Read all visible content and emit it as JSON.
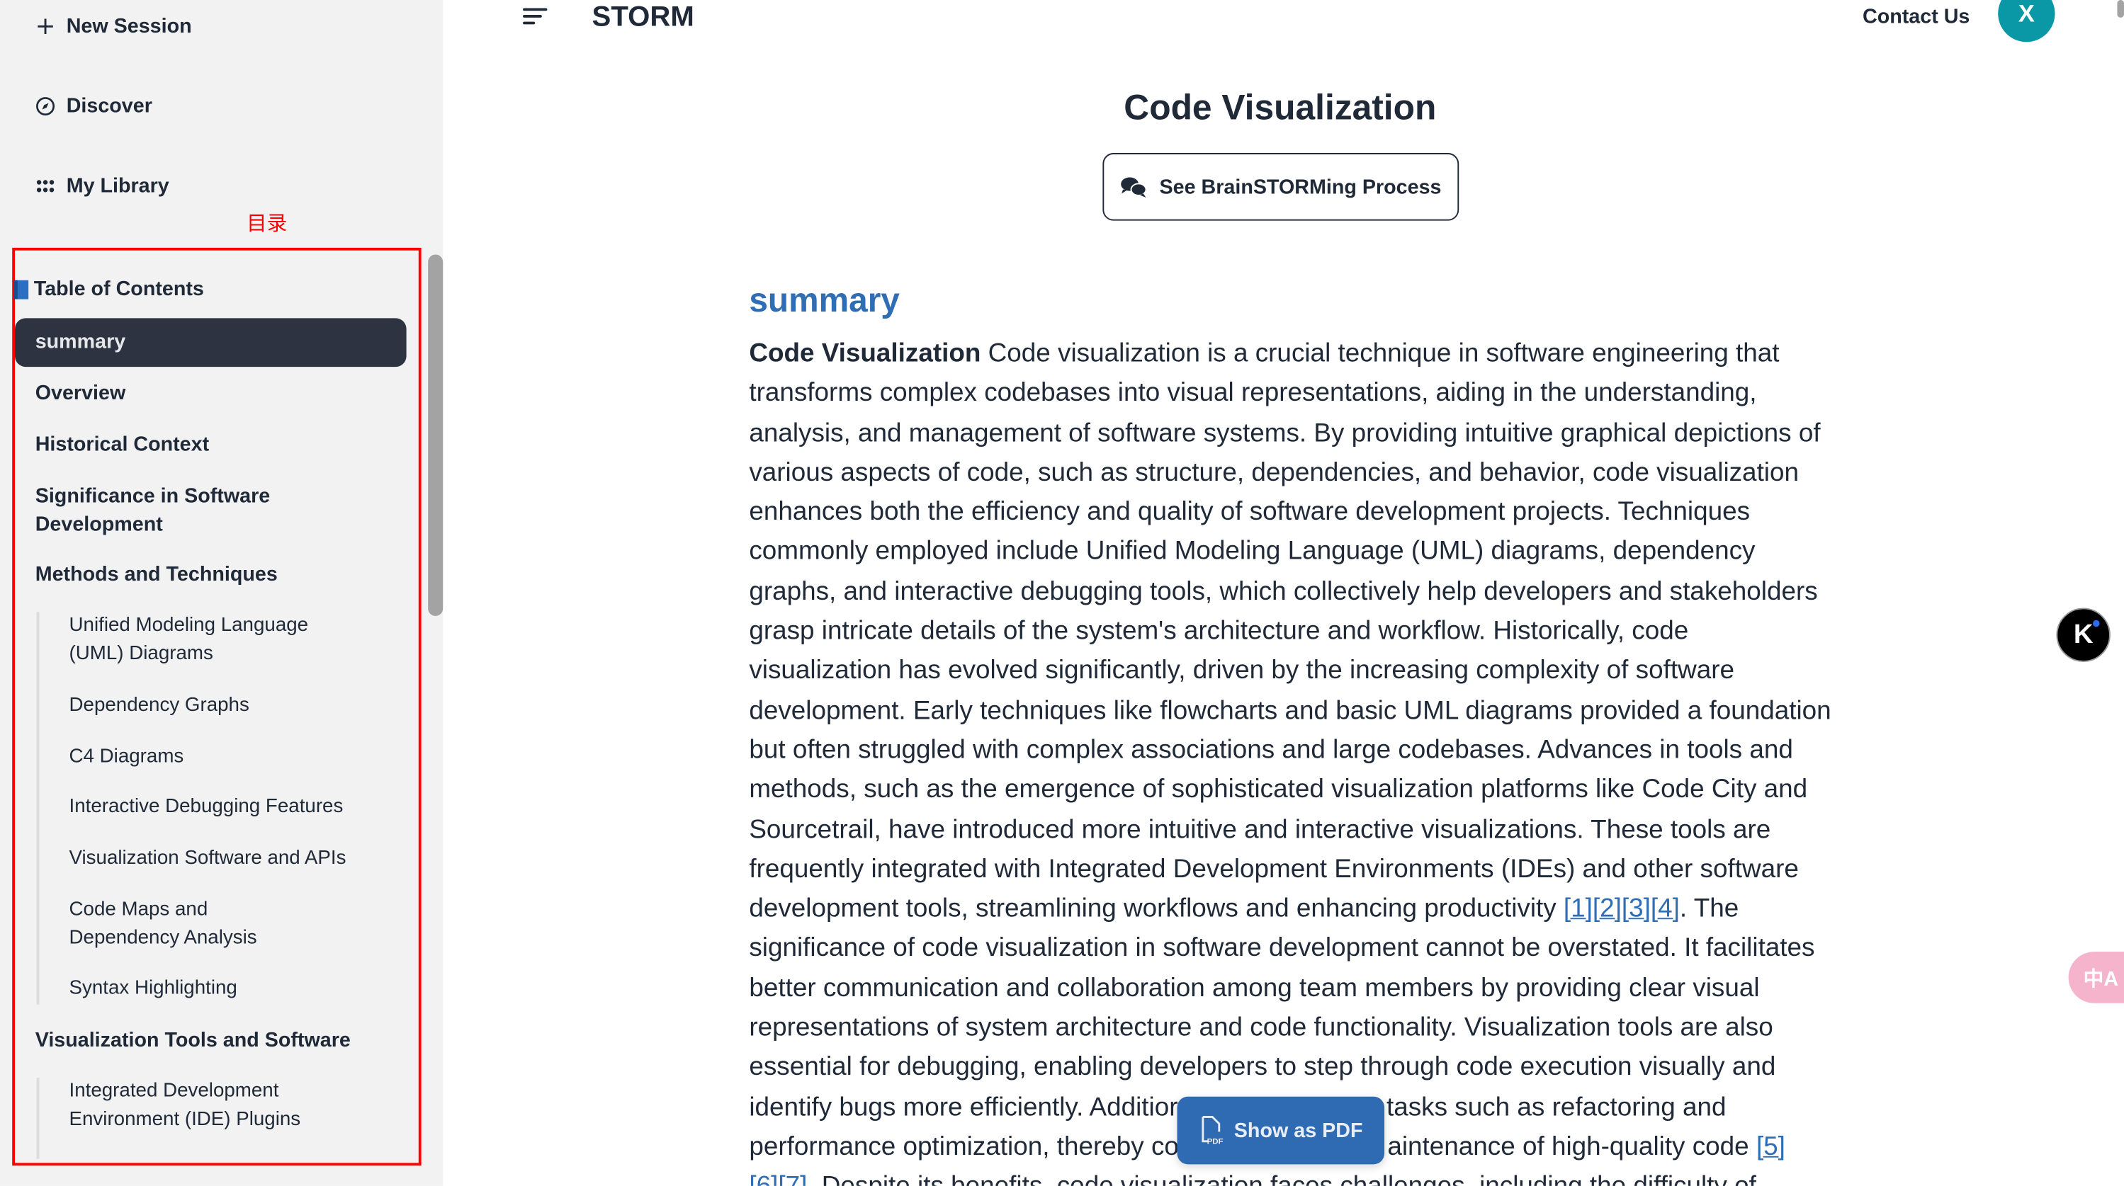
{
  "sidebar": {
    "nav": [
      {
        "label": "New Session",
        "icon": "plus-icon"
      },
      {
        "label": "Discover",
        "icon": "compass-icon"
      },
      {
        "label": "My Library",
        "icon": "grid-icon"
      }
    ],
    "annotation": "目录",
    "toc_title": "Table of Contents",
    "toc_icon": "book-icon",
    "toc": [
      {
        "label": "summary",
        "active": true
      },
      {
        "label": "Overview"
      },
      {
        "label": "Historical Context"
      },
      {
        "label": "Significance in Software Development"
      },
      {
        "label": "Methods and Techniques",
        "children": [
          "Unified Modeling Language (UML) Diagrams",
          "Dependency Graphs",
          "C4 Diagrams",
          "Interactive Debugging Features",
          "Visualization Software and APIs",
          "Code Maps and Dependency Analysis",
          "Syntax Highlighting"
        ]
      },
      {
        "label": "Visualization Tools and Software",
        "children": [
          "Integrated Development Environment (IDE) Plugins"
        ]
      }
    ]
  },
  "header": {
    "brand": "STORM",
    "contact": "Contact Us",
    "avatar": "X",
    "avatar_color": "#0a97a6"
  },
  "article": {
    "title": "Code Visualization",
    "brainstorm_button": "See BrainSTORMing Process",
    "section_heading": "summary",
    "lead_bold": "Code Visualization",
    "lines": [
      [
        {
          "t": " Code visualization is a crucial technique in software engineering that"
        }
      ],
      [
        {
          "t": "transforms complex codebases into visual representations, aiding in the understanding,"
        }
      ],
      [
        {
          "t": "analysis, and management of software systems. By providing intuitive graphical depictions of"
        }
      ],
      [
        {
          "t": "various aspects of code, such as structure, dependencies, and behavior, code visualization"
        }
      ],
      [
        {
          "t": "enhances both the efficiency and quality of software development projects. Techniques"
        }
      ],
      [
        {
          "t": "commonly employed include Unified Modeling Language (UML) diagrams, dependency"
        }
      ],
      [
        {
          "t": "graphs, and interactive debugging tools, which collectively help developers and stakeholders"
        }
      ],
      [
        {
          "t": "grasp intricate details of the system's architecture and workflow. Historically, code"
        }
      ],
      [
        {
          "t": "visualization has evolved significantly, driven by the increasing complexity of software"
        }
      ],
      [
        {
          "t": "development. Early techniques like flowcharts and basic UML diagrams provided a foundation"
        }
      ],
      [
        {
          "t": "but often struggled with complex associations and large codebases. Advances in tools and"
        }
      ],
      [
        {
          "t": "methods, such as the emergence of sophisticated visualization platforms like Code City and"
        }
      ],
      [
        {
          "t": "Sourcetrail, have introduced more intuitive and interactive visualizations. These tools are"
        }
      ],
      [
        {
          "t": "frequently integrated with Integrated Development Environments (IDEs) and other software"
        }
      ],
      [
        {
          "t": "development tools, streamlining workflows and enhancing productivity "
        },
        {
          "cite": "[1]"
        },
        {
          "cite": "[2]"
        },
        {
          "cite": "[3]"
        },
        {
          "cite": "[4]"
        },
        {
          "t": ". The"
        }
      ],
      [
        {
          "t": "significance of code visualization in software development cannot be overstated. It facilitates"
        }
      ],
      [
        {
          "t": "better communication and collaboration among team members by providing clear visual"
        }
      ],
      [
        {
          "t": "representations of system architecture and code functionality. Visualization tools are also"
        }
      ],
      [
        {
          "t": "essential for debugging, enabling developers to step through code execution visually and"
        }
      ],
      [
        {
          "t": "identify bugs more efficiently. Additior"
        },
        {
          "gap": true
        },
        {
          "t": "tasks such as refactoring and"
        }
      ],
      [
        {
          "t": "performance optimization, thereby co"
        },
        {
          "gap": true
        },
        {
          "t": "aintenance of high-quality code "
        },
        {
          "cite": "[5]"
        }
      ],
      [
        {
          "cite": "[6]"
        },
        {
          "cite": "[7]"
        },
        {
          "t": ". Despite its benefits, code visualization faces challenges, including the difficulty of"
        }
      ]
    ],
    "link_color": "#2f6db5"
  },
  "floating": {
    "pdf_button": "Show as PDF",
    "assistant_icon": "K",
    "translate_icon": "中A"
  }
}
